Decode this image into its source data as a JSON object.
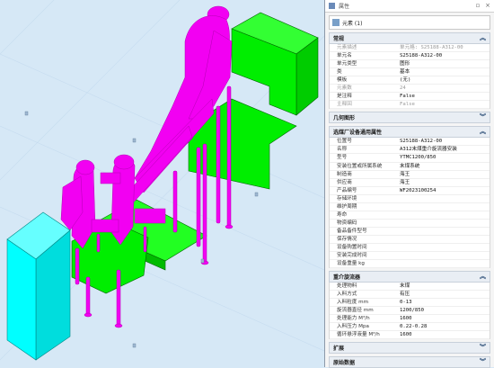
{
  "panel": {
    "title": "属性",
    "selector": "元素 (1)",
    "sections": {
      "general": {
        "title": "常规",
        "rows": [
          {
            "k": "元素描述",
            "v": "单元格: S25188-A312-00",
            "dim": true
          },
          {
            "k": "单元名",
            "v": "S25188-A312-00"
          },
          {
            "k": "单元类型",
            "v": "图形"
          },
          {
            "k": "类",
            "v": "基本"
          },
          {
            "k": "模板",
            "v": "(无)"
          },
          {
            "k": "元素数",
            "v": "24",
            "dim": true
          },
          {
            "k": "是注释",
            "v": "False"
          },
          {
            "k": "主释回",
            "v": "False",
            "dim": true
          }
        ]
      },
      "geometry": {
        "title": "几何图形"
      },
      "factory": {
        "title": "选煤厂设备通用属性",
        "rows": [
          {
            "k": "位置号",
            "v": "S25188-A312-00"
          },
          {
            "k": "名称",
            "v": "A312末煤重介旋流器安装"
          },
          {
            "k": "型号",
            "v": "YTMC1200/850"
          },
          {
            "k": "安装位置或所属系统",
            "v": "末煤系统"
          },
          {
            "k": "制造商",
            "v": "海王"
          },
          {
            "k": "供应商",
            "v": "海王"
          },
          {
            "k": "产品编号",
            "v": "WF2023100254"
          },
          {
            "k": "存储环境",
            "v": ""
          },
          {
            "k": "维护周期",
            "v": ""
          },
          {
            "k": "寿命",
            "v": ""
          },
          {
            "k": "物资编码",
            "v": ""
          },
          {
            "k": "备品备件型号",
            "v": ""
          },
          {
            "k": "保存情况",
            "v": ""
          },
          {
            "k": "设备购置时间",
            "v": ""
          },
          {
            "k": "安装完成时间",
            "v": ""
          },
          {
            "k": "设备重量 kg",
            "v": ""
          }
        ]
      },
      "cyclone": {
        "title": "重介旋流器",
        "rows": [
          {
            "k": "处理物料",
            "v": "末煤"
          },
          {
            "k": "入料方式",
            "v": "有压"
          },
          {
            "k": "入料粒度 mm",
            "v": "0-13"
          },
          {
            "k": "旋流器直径 mm",
            "v": "1200/850"
          },
          {
            "k": "处理能力 M³/h",
            "v": "1600"
          },
          {
            "k": "入料压力 Mpa",
            "v": "0.22-0.28"
          },
          {
            "k": "循环悬浮液量 M³/h",
            "v": "1600"
          }
        ]
      },
      "extension": {
        "title": "扩展"
      },
      "raw": {
        "title": "原始数据"
      }
    }
  },
  "colors": {
    "viewport_bg": "#d6e8f6",
    "equipment_magenta": "#f200f2",
    "platform_green": "#00ee00",
    "tank_cyan": "#00ffff"
  }
}
